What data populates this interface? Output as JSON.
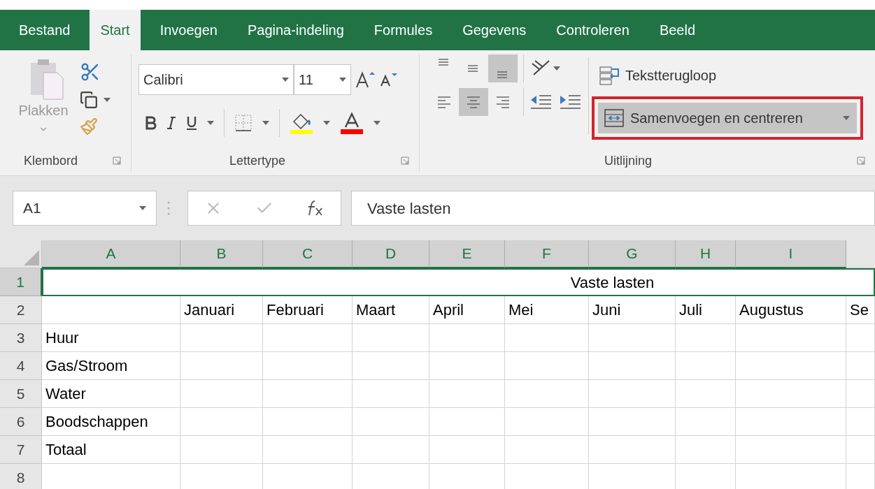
{
  "tabs": [
    {
      "label": "Bestand",
      "selected": false
    },
    {
      "label": "Start",
      "selected": true
    },
    {
      "label": "Invoegen",
      "selected": false
    },
    {
      "label": "Pagina-indeling",
      "selected": false
    },
    {
      "label": "Formules",
      "selected": false
    },
    {
      "label": "Gegevens",
      "selected": false
    },
    {
      "label": "Controleren",
      "selected": false
    },
    {
      "label": "Beeld",
      "selected": false
    }
  ],
  "ribbon": {
    "clipboard": {
      "paste_label": "Plakken",
      "paste_disabled": true,
      "group_label": "Klembord"
    },
    "font": {
      "font_name": "Calibri",
      "font_size": "11",
      "group_label": "Lettertype"
    },
    "alignment": {
      "vertical": [
        {
          "kind": "top",
          "selected": false
        },
        {
          "kind": "middle",
          "selected": false
        },
        {
          "kind": "bottom",
          "selected": true
        }
      ],
      "horizontal": [
        {
          "kind": "left",
          "selected": false
        },
        {
          "kind": "center",
          "selected": true
        },
        {
          "kind": "right",
          "selected": false
        }
      ],
      "wrap_label": "Tekstterugloop",
      "merge_label": "Samenvoegen en centreren",
      "merge_selected": true,
      "merge_highlighted": true,
      "group_label": "Uitlijning"
    }
  },
  "formula_bar": {
    "name_box": "A1",
    "formula": "Vaste lasten"
  },
  "grid": {
    "columns": [
      {
        "label": "A",
        "selected": true
      },
      {
        "label": "B",
        "selected": true
      },
      {
        "label": "C",
        "selected": true
      },
      {
        "label": "D",
        "selected": true
      },
      {
        "label": "E",
        "selected": true
      },
      {
        "label": "F",
        "selected": true
      },
      {
        "label": "G",
        "selected": true
      },
      {
        "label": "H",
        "selected": true
      },
      {
        "label": "I",
        "selected": true
      }
    ],
    "rows": [
      {
        "number": "1",
        "selected": true,
        "title": "Vaste lasten"
      },
      {
        "number": "2",
        "selected": false,
        "values": [
          "Januari",
          "Februari",
          "Maart",
          "April",
          "Mei",
          "Juni",
          "Juli",
          "Augustus",
          "Se"
        ]
      },
      {
        "number": "3",
        "selected": false,
        "label": "Huur"
      },
      {
        "number": "4",
        "selected": false,
        "label": "Gas/Stroom"
      },
      {
        "number": "5",
        "selected": false,
        "label": "Water"
      },
      {
        "number": "6",
        "selected": false,
        "label": "Boodschappen"
      },
      {
        "number": "7",
        "selected": false,
        "label": "Totaal"
      },
      {
        "number": "8",
        "selected": false
      }
    ]
  }
}
